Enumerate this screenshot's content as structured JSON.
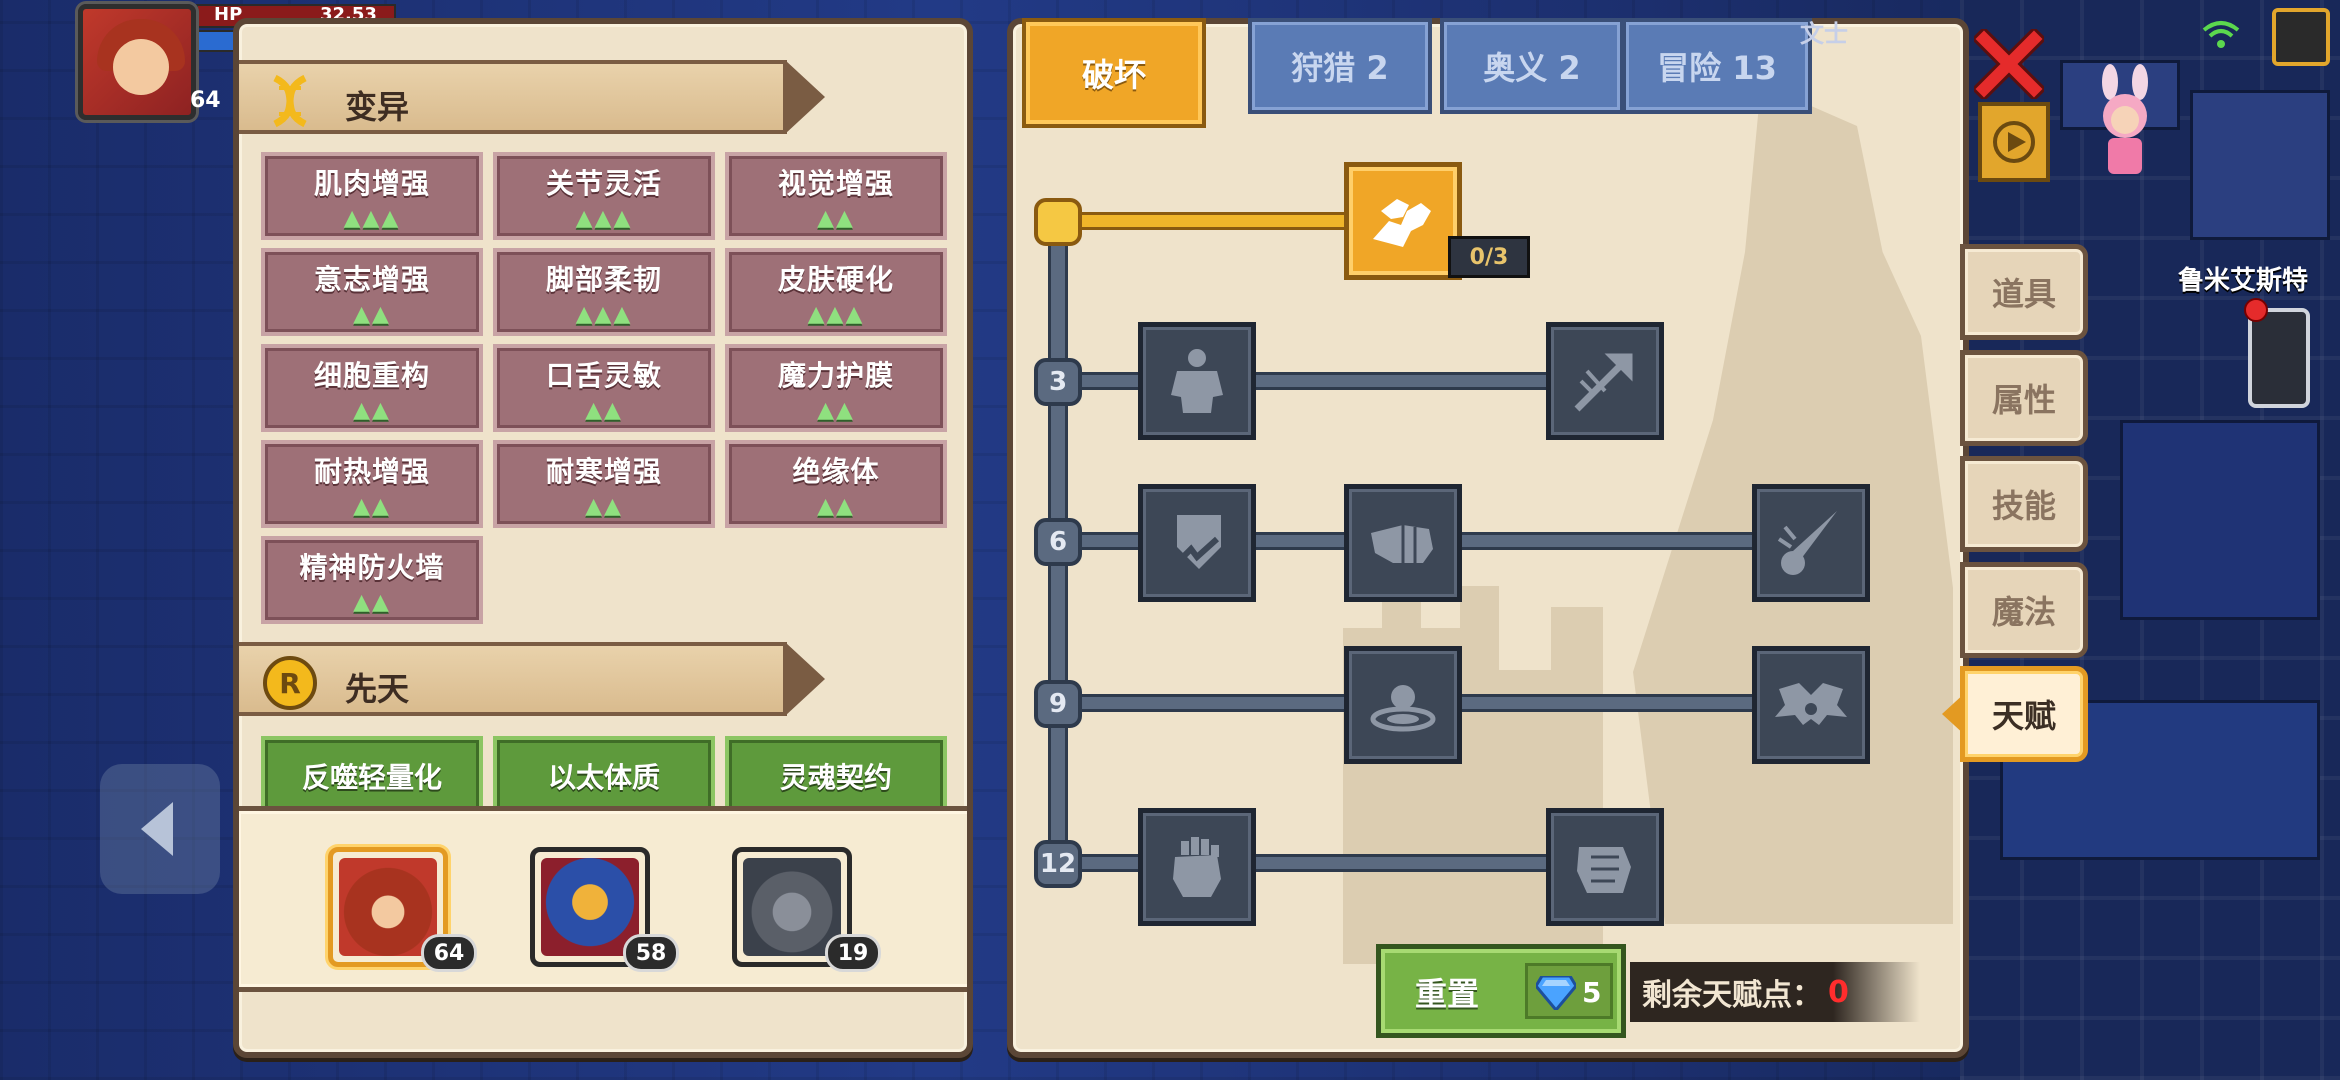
{
  "hud": {
    "hp_label": "HP",
    "hp_value": "32.53",
    "level": "64"
  },
  "left_panel": {
    "mutation_section": {
      "title": "变异",
      "traits": [
        {
          "name": "肌肉增强",
          "arrows": "▲▲▲"
        },
        {
          "name": "关节灵活",
          "arrows": "▲▲▲"
        },
        {
          "name": "视觉增强",
          "arrows": "▲▲"
        },
        {
          "name": "意志增强",
          "arrows": "▲▲"
        },
        {
          "name": "脚部柔韧",
          "arrows": "▲▲▲"
        },
        {
          "name": "皮肤硬化",
          "arrows": "▲▲▲"
        },
        {
          "name": "细胞重构",
          "arrows": "▲▲"
        },
        {
          "name": "口舌灵敏",
          "arrows": "▲▲"
        },
        {
          "name": "魔力护膜",
          "arrows": "▲▲"
        },
        {
          "name": "耐热增强",
          "arrows": "▲▲"
        },
        {
          "name": "耐寒增强",
          "arrows": "▲▲"
        },
        {
          "name": "绝缘体",
          "arrows": "▲▲"
        },
        {
          "name": "精神防火墙",
          "arrows": "▲▲"
        }
      ]
    },
    "innate_section": {
      "title": "先天",
      "icon_text": "R",
      "traits": [
        "反噬轻量化",
        "以太体质",
        "灵魂契约"
      ]
    },
    "party": [
      {
        "level": "64",
        "selected": true
      },
      {
        "level": "58",
        "selected": false
      },
      {
        "level": "19",
        "selected": false
      }
    ]
  },
  "right_panel": {
    "tabs": [
      {
        "label": "破坏",
        "active": true
      },
      {
        "label": "狩猎 2",
        "active": false
      },
      {
        "label": "奥义 2",
        "active": false
      },
      {
        "label": "冒险 13",
        "active": false
      }
    ],
    "tree_levels": [
      "3",
      "6",
      "9",
      "12"
    ],
    "root_talent_count": "0/3",
    "talent_icons": {
      "root": "arm-wrestle-icon",
      "row3": [
        "muscle-body-icon",
        "arrow-hit-icon"
      ],
      "row6": [
        "shield-break-icon",
        "punch-icon",
        "blade-slash-icon"
      ],
      "row9": [
        "ground-impact-icon",
        "bat-wings-icon"
      ],
      "row12": [
        "fist-icon",
        "grip-fist-icon"
      ]
    },
    "reset_button": {
      "label": "重置",
      "cost": "5"
    },
    "remaining": {
      "label": "剩余天赋点：",
      "value": "0"
    }
  },
  "side_tabs": [
    {
      "label": "道具",
      "active": false
    },
    {
      "label": "属性",
      "active": false
    },
    {
      "label": "技能",
      "active": false
    },
    {
      "label": "魔法",
      "active": false
    },
    {
      "label": "天赋",
      "active": true
    }
  ],
  "map": {
    "location_label": "鲁米艾斯特",
    "top_text": "文士"
  },
  "colors": {
    "active_tab": "#f0a627",
    "trait_cell": "#9e7077",
    "innate_cell": "#5e9a3c",
    "remaining_value": "#ff2d2d",
    "close_icon": "#e52b2b"
  }
}
